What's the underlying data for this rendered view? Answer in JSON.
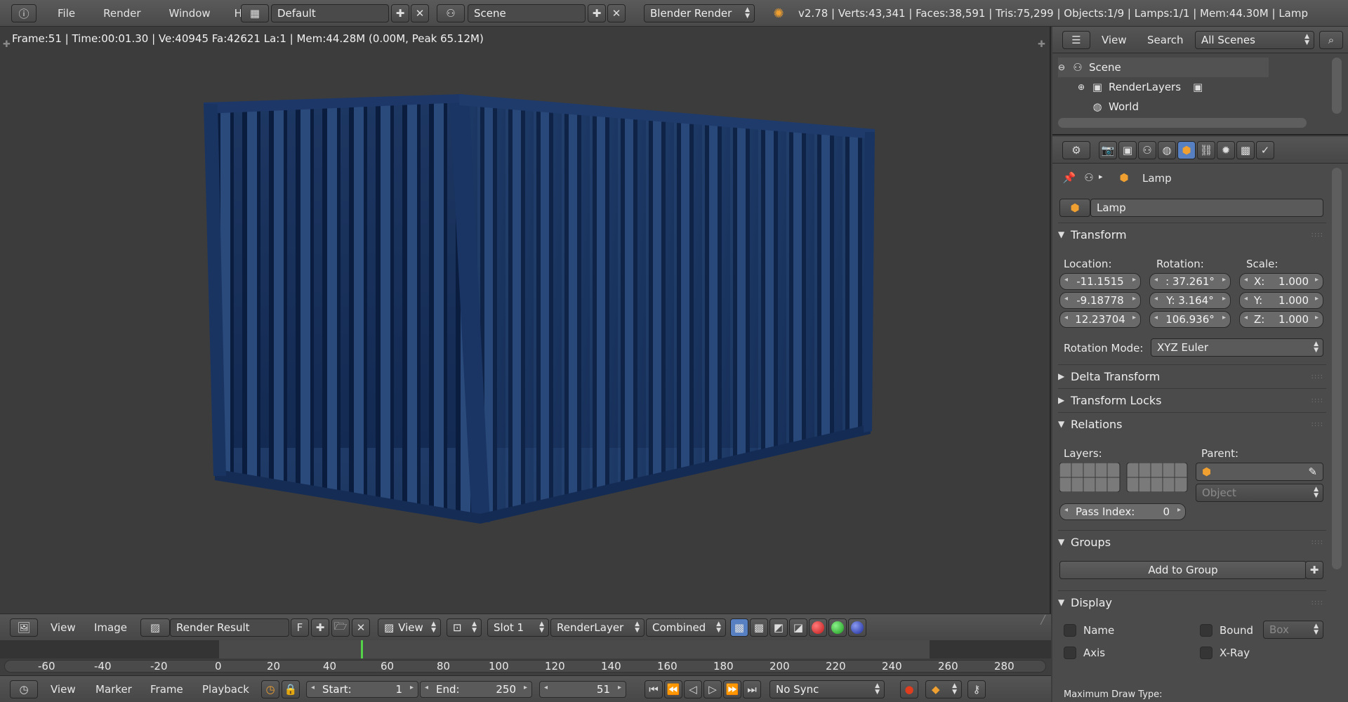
{
  "topbar": {
    "menus": [
      "File",
      "Render",
      "Window",
      "Help"
    ],
    "layout_name": "Default",
    "scene_name": "Scene",
    "render_engine": "Blender Render",
    "stats": "v2.78 | Verts:43,341 | Faces:38,591 | Tris:75,299 | Objects:1/9 | Lamps:1/1 | Mem:44.30M | Lamp"
  },
  "viewport": {
    "info": "Frame:51 | Time:00:01.30 | Ve:40945 Fa:42621 La:1 | Mem:44.28M (0.00M, Peak 65.12M)"
  },
  "outliner": {
    "menus": [
      "View",
      "Search"
    ],
    "filter": "All Scenes",
    "items": [
      "Scene",
      "RenderLayers",
      "World"
    ]
  },
  "properties": {
    "breadcrumb": "Lamp",
    "object_name": "Lamp",
    "transform": {
      "title": "Transform",
      "location_label": "Location:",
      "rotation_label": "Rotation:",
      "scale_label": "Scale:",
      "location": [
        "-11.1515",
        "-9.18778",
        "12.23704"
      ],
      "rotation": [
        ": 37.261°",
        "Y:  3.164°",
        "106.936°"
      ],
      "scale_axes": [
        "X:",
        "Y:",
        "Z:"
      ],
      "scale": [
        "1.000",
        "1.000",
        "1.000"
      ],
      "rotation_mode_label": "Rotation Mode:",
      "rotation_mode": "XYZ Euler"
    },
    "delta_transform": "Delta Transform",
    "transform_locks": "Transform Locks",
    "relations": {
      "title": "Relations",
      "layers_label": "Layers:",
      "parent_label": "Parent:",
      "parent_type": "Object",
      "pass_index_label": "Pass Index:",
      "pass_index": "0"
    },
    "groups": {
      "title": "Groups",
      "add_label": "Add to Group"
    },
    "display": {
      "title": "Display",
      "name_label": "Name",
      "bound_label": "Bound",
      "bound_type": "Box",
      "axis_label": "Axis",
      "xray_label": "X-Ray",
      "max_draw_label": "Maximum Draw Type:"
    }
  },
  "image_editor": {
    "menus": [
      "View",
      "Image"
    ],
    "image_name": "Render Result",
    "fake_user": "F",
    "view_label": "View",
    "slot": "Slot 1",
    "render_layer": "RenderLayer",
    "pass": "Combined"
  },
  "timeline": {
    "ticks": [
      "-60",
      "-40",
      "-20",
      "0",
      "20",
      "40",
      "60",
      "80",
      "100",
      "120",
      "140",
      "160",
      "180",
      "200",
      "220",
      "240",
      "260",
      "280"
    ],
    "current_frame_marker": 51,
    "menus": [
      "View",
      "Marker",
      "Frame",
      "Playback"
    ],
    "start_label": "Start:",
    "start": "1",
    "end_label": "End:",
    "end": "250",
    "current_frame": "51",
    "sync": "No Sync"
  },
  "colors": {
    "container": "#1c3560",
    "accent_orange": "#f0a030",
    "record_red": "#e03c1e"
  }
}
